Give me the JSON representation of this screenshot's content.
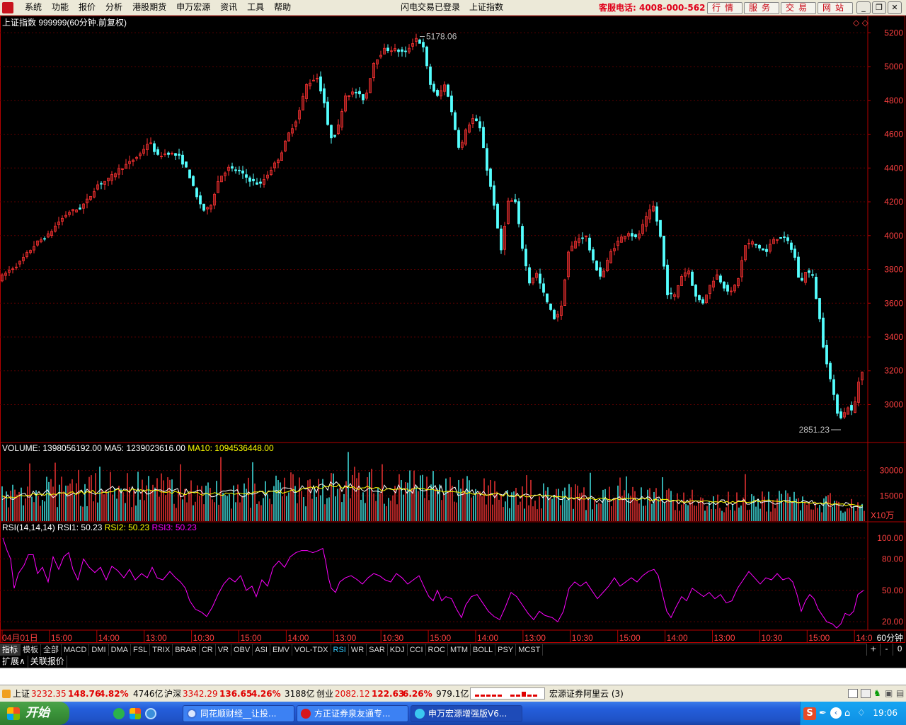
{
  "menubar": {
    "items": [
      "系统",
      "功能",
      "报价",
      "分析",
      "港股期货",
      "申万宏源",
      "资讯",
      "工具",
      "帮助"
    ],
    "login_status": "闪电交易已登录",
    "index_name": "上证指数",
    "hotline": "客服电话: 4008-000-562",
    "right_buttons": [
      "行情",
      "服务",
      "交易",
      "网站"
    ]
  },
  "chart": {
    "header": "上证指数 999999(60分钟.前复权)",
    "high_label": "5178.06",
    "low_label": "2851.23",
    "volume_header": {
      "vol": "VOLUME: 1398056192.00",
      "ma5": "MA5: 1239023616.00",
      "ma10": "MA10: 1094536448.00"
    },
    "volume_unit": "X10万",
    "rsi_header": {
      "name": "RSI(14,14,14)",
      "r1": "RSI1: 50.23",
      "r2": "RSI2: 50.23",
      "r3": "RSI3: 50.23"
    },
    "period_label": "60分钟",
    "time_labels": [
      "04月01日",
      "15:00",
      "14:00",
      "13:00",
      "10:30",
      "15:00",
      "14:00",
      "13:00",
      "10:30",
      "15:00",
      "14:00",
      "13:00",
      "10:30",
      "15:00",
      "14:00",
      "13:00",
      "10:30",
      "15:00",
      "14:0"
    ]
  },
  "chart_data": {
    "type": "candlestick",
    "price_axis": {
      "ticks": [
        5200,
        5000,
        4800,
        4600,
        4400,
        4200,
        4000,
        3800,
        3600,
        3400,
        3200,
        3000
      ],
      "range": [
        2780,
        5260
      ]
    },
    "price_path": [
      [
        0,
        3740
      ],
      [
        14,
        3790
      ],
      [
        28,
        3830
      ],
      [
        42,
        3900
      ],
      [
        55,
        3960
      ],
      [
        70,
        4000
      ],
      [
        85,
        4080
      ],
      [
        100,
        4140
      ],
      [
        115,
        4160
      ],
      [
        128,
        4220
      ],
      [
        140,
        4300
      ],
      [
        155,
        4330
      ],
      [
        170,
        4390
      ],
      [
        185,
        4430
      ],
      [
        200,
        4480
      ],
      [
        213,
        4560
      ],
      [
        225,
        4470
      ],
      [
        240,
        4490
      ],
      [
        255,
        4470
      ],
      [
        268,
        4380
      ],
      [
        280,
        4230
      ],
      [
        292,
        4140
      ],
      [
        300,
        4180
      ],
      [
        312,
        4340
      ],
      [
        325,
        4400
      ],
      [
        340,
        4380
      ],
      [
        355,
        4330
      ],
      [
        370,
        4300
      ],
      [
        385,
        4390
      ],
      [
        398,
        4470
      ],
      [
        410,
        4600
      ],
      [
        423,
        4700
      ],
      [
        435,
        4890
      ],
      [
        450,
        4940
      ],
      [
        460,
        4800
      ],
      [
        468,
        4580
      ],
      [
        478,
        4600
      ],
      [
        490,
        4830
      ],
      [
        505,
        4850
      ],
      [
        518,
        4800
      ],
      [
        530,
        5020
      ],
      [
        545,
        5100
      ],
      [
        560,
        5100
      ],
      [
        575,
        5080
      ],
      [
        590,
        5170
      ],
      [
        600,
        5120
      ],
      [
        610,
        4900
      ],
      [
        620,
        4820
      ],
      [
        632,
        4900
      ],
      [
        643,
        4680
      ],
      [
        652,
        4500
      ],
      [
        662,
        4640
      ],
      [
        672,
        4700
      ],
      [
        682,
        4620
      ],
      [
        690,
        4400
      ],
      [
        700,
        4200
      ],
      [
        710,
        3900
      ],
      [
        720,
        4200
      ],
      [
        730,
        4210
      ],
      [
        740,
        3940
      ],
      [
        750,
        3720
      ],
      [
        760,
        3780
      ],
      [
        772,
        3640
      ],
      [
        785,
        3510
      ],
      [
        795,
        3560
      ],
      [
        805,
        3900
      ],
      [
        818,
        3980
      ],
      [
        830,
        4000
      ],
      [
        840,
        3850
      ],
      [
        852,
        3750
      ],
      [
        865,
        3900
      ],
      [
        878,
        3980
      ],
      [
        890,
        4020
      ],
      [
        902,
        3980
      ],
      [
        915,
        4100
      ],
      [
        925,
        4180
      ],
      [
        935,
        4010
      ],
      [
        945,
        3660
      ],
      [
        955,
        3640
      ],
      [
        965,
        3760
      ],
      [
        975,
        3800
      ],
      [
        985,
        3640
      ],
      [
        995,
        3600
      ],
      [
        1005,
        3700
      ],
      [
        1015,
        3770
      ],
      [
        1025,
        3700
      ],
      [
        1035,
        3660
      ],
      [
        1045,
        3740
      ],
      [
        1055,
        3940
      ],
      [
        1065,
        3960
      ],
      [
        1075,
        3930
      ],
      [
        1085,
        3900
      ],
      [
        1095,
        3980
      ],
      [
        1105,
        3990
      ],
      [
        1115,
        3970
      ],
      [
        1125,
        3880
      ],
      [
        1133,
        3700
      ],
      [
        1140,
        3790
      ],
      [
        1150,
        3770
      ],
      [
        1160,
        3520
      ],
      [
        1165,
        3360
      ],
      [
        1172,
        3220
      ],
      [
        1178,
        3100
      ],
      [
        1185,
        2960
      ],
      [
        1192,
        2920
      ],
      [
        1200,
        2990
      ],
      [
        1208,
        2950
      ],
      [
        1215,
        3130
      ],
      [
        1222,
        3220
      ]
    ],
    "volume_axis": {
      "ticks": [
        30000,
        15000
      ],
      "unit": "X10万",
      "range": [
        0,
        42000
      ]
    },
    "volume_avg": [
      [
        0,
        14000
      ],
      [
        60,
        16000
      ],
      [
        120,
        17000
      ],
      [
        180,
        18500
      ],
      [
        240,
        17000
      ],
      [
        300,
        16000
      ],
      [
        360,
        16500
      ],
      [
        420,
        18000
      ],
      [
        470,
        21000
      ],
      [
        540,
        19000
      ],
      [
        600,
        19000
      ],
      [
        660,
        17000
      ],
      [
        720,
        15500
      ],
      [
        780,
        14500
      ],
      [
        840,
        13000
      ],
      [
        900,
        13000
      ],
      [
        960,
        12000
      ],
      [
        1020,
        11000
      ],
      [
        1080,
        12000
      ],
      [
        1140,
        11000
      ],
      [
        1222,
        9000
      ]
    ],
    "rsi_axis": {
      "ticks": [
        100,
        80,
        50,
        20
      ],
      "range": [
        12,
        108
      ]
    },
    "rsi_path": [
      [
        4,
        100
      ],
      [
        10,
        88
      ],
      [
        15,
        80
      ],
      [
        20,
        52
      ],
      [
        26,
        66
      ],
      [
        34,
        74
      ],
      [
        40,
        84
      ],
      [
        47,
        84
      ],
      [
        53,
        66
      ],
      [
        60,
        72
      ],
      [
        68,
        58
      ],
      [
        75,
        82
      ],
      [
        83,
        70
      ],
      [
        90,
        82
      ],
      [
        97,
        86
      ],
      [
        103,
        70
      ],
      [
        110,
        60
      ],
      [
        118,
        80
      ],
      [
        126,
        72
      ],
      [
        134,
        67
      ],
      [
        142,
        72
      ],
      [
        150,
        60
      ],
      [
        158,
        73
      ],
      [
        166,
        69
      ],
      [
        175,
        62
      ],
      [
        183,
        70
      ],
      [
        191,
        60
      ],
      [
        200,
        66
      ],
      [
        208,
        62
      ],
      [
        215,
        72
      ],
      [
        222,
        62
      ],
      [
        230,
        60
      ],
      [
        240,
        68
      ],
      [
        248,
        62
      ],
      [
        255,
        58
      ],
      [
        262,
        52
      ],
      [
        268,
        40
      ],
      [
        276,
        32
      ],
      [
        285,
        29
      ],
      [
        292,
        25
      ],
      [
        300,
        34
      ],
      [
        308,
        46
      ],
      [
        316,
        56
      ],
      [
        324,
        62
      ],
      [
        332,
        58
      ],
      [
        340,
        64
      ],
      [
        348,
        50
      ],
      [
        356,
        54
      ],
      [
        362,
        44
      ],
      [
        370,
        60
      ],
      [
        378,
        54
      ],
      [
        386,
        72
      ],
      [
        394,
        78
      ],
      [
        402,
        72
      ],
      [
        410,
        82
      ],
      [
        418,
        86
      ],
      [
        426,
        88
      ],
      [
        434,
        88
      ],
      [
        442,
        86
      ],
      [
        450,
        88
      ],
      [
        456,
        90
      ],
      [
        460,
        78
      ],
      [
        464,
        62
      ],
      [
        468,
        52
      ],
      [
        474,
        48
      ],
      [
        480,
        58
      ],
      [
        488,
        62
      ],
      [
        496,
        64
      ],
      [
        505,
        60
      ],
      [
        512,
        56
      ],
      [
        520,
        62
      ],
      [
        528,
        66
      ],
      [
        536,
        64
      ],
      [
        544,
        60
      ],
      [
        552,
        58
      ],
      [
        560,
        66
      ],
      [
        568,
        62
      ],
      [
        576,
        56
      ],
      [
        584,
        60
      ],
      [
        592,
        64
      ],
      [
        600,
        52
      ],
      [
        606,
        44
      ],
      [
        612,
        40
      ],
      [
        618,
        50
      ],
      [
        624,
        40
      ],
      [
        630,
        44
      ],
      [
        638,
        42
      ],
      [
        645,
        32
      ],
      [
        652,
        24
      ],
      [
        658,
        36
      ],
      [
        666,
        44
      ],
      [
        674,
        46
      ],
      [
        682,
        38
      ],
      [
        690,
        30
      ],
      [
        698,
        25
      ],
      [
        706,
        22
      ],
      [
        714,
        34
      ],
      [
        722,
        48
      ],
      [
        730,
        44
      ],
      [
        738,
        36
      ],
      [
        746,
        28
      ],
      [
        754,
        22
      ],
      [
        762,
        30
      ],
      [
        770,
        26
      ],
      [
        780,
        24
      ],
      [
        788,
        20
      ],
      [
        796,
        30
      ],
      [
        804,
        52
      ],
      [
        812,
        58
      ],
      [
        820,
        54
      ],
      [
        828,
        58
      ],
      [
        836,
        50
      ],
      [
        844,
        42
      ],
      [
        852,
        48
      ],
      [
        860,
        54
      ],
      [
        868,
        62
      ],
      [
        876,
        54
      ],
      [
        884,
        58
      ],
      [
        892,
        62
      ],
      [
        900,
        58
      ],
      [
        908,
        64
      ],
      [
        916,
        68
      ],
      [
        924,
        70
      ],
      [
        930,
        64
      ],
      [
        936,
        46
      ],
      [
        942,
        30
      ],
      [
        948,
        24
      ],
      [
        955,
        34
      ],
      [
        963,
        44
      ],
      [
        970,
        40
      ],
      [
        978,
        52
      ],
      [
        986,
        48
      ],
      [
        994,
        44
      ],
      [
        1002,
        48
      ],
      [
        1010,
        42
      ],
      [
        1018,
        46
      ],
      [
        1026,
        38
      ],
      [
        1034,
        40
      ],
      [
        1042,
        52
      ],
      [
        1050,
        60
      ],
      [
        1058,
        68
      ],
      [
        1066,
        62
      ],
      [
        1074,
        56
      ],
      [
        1082,
        62
      ],
      [
        1090,
        60
      ],
      [
        1098,
        66
      ],
      [
        1106,
        60
      ],
      [
        1114,
        62
      ],
      [
        1120,
        58
      ],
      [
        1126,
        46
      ],
      [
        1132,
        30
      ],
      [
        1138,
        40
      ],
      [
        1144,
        46
      ],
      [
        1150,
        42
      ],
      [
        1156,
        32
      ],
      [
        1162,
        26
      ],
      [
        1168,
        20
      ],
      [
        1176,
        18
      ],
      [
        1182,
        14
      ],
      [
        1188,
        18
      ],
      [
        1194,
        28
      ],
      [
        1200,
        26
      ],
      [
        1206,
        30
      ],
      [
        1212,
        46
      ],
      [
        1220,
        50
      ]
    ]
  },
  "tabs": {
    "row1": [
      "指标",
      "模板",
      "全部",
      "MACD",
      "DMI",
      "DMA",
      "FSL",
      "TRIX",
      "BRAR",
      "CR",
      "VR",
      "OBV",
      "ASI",
      "EMV",
      "VOL-TDX",
      "RSI",
      "WR",
      "SAR",
      "KDJ",
      "CCI",
      "ROC",
      "MTM",
      "BOLL",
      "PSY",
      "MCST"
    ],
    "row1_controls": [
      "+",
      "-",
      "0"
    ],
    "row2": [
      "扩展∧",
      "关联报价"
    ]
  },
  "statusbar": {
    "sh": {
      "name": "上证",
      "price": "3232.35",
      "chg": "148.76",
      "pct": "4.82%",
      "amount": "4746亿"
    },
    "hs": {
      "name": "沪深",
      "price": "3342.29",
      "chg": "136.65",
      "pct": "4.26%",
      "amount": "3188亿"
    },
    "cy": {
      "name": "创业",
      "price": "2082.12",
      "chg": "122.63",
      "pct": "6.26%",
      "amount": "979.1亿"
    },
    "server": "宏源证券阿里云 (3)"
  },
  "taskbar": {
    "start": "开始",
    "tasks": [
      "同花顺财经__让投...",
      "方正证券泉友通专...",
      "申万宏源增强版V6..."
    ],
    "clock": "19:06"
  },
  "colors": {
    "up": "#ff3232",
    "down": "#54ffff",
    "ma5": "#ffffff",
    "ma10": "#ffff00",
    "rsi": "#ff00ff",
    "axis": "#b40000"
  }
}
